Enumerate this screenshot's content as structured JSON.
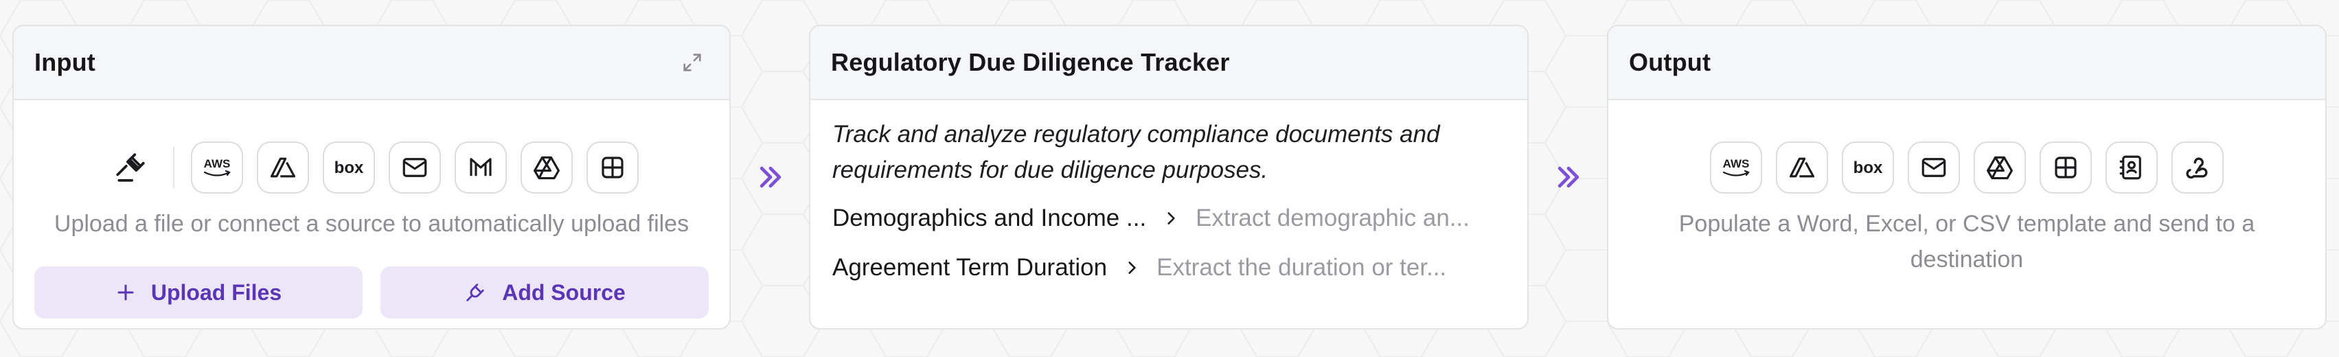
{
  "input": {
    "title": "Input",
    "helper_text": "Upload a file or connect a source to automatically upload files",
    "upload_label": "Upload Files",
    "add_source_label": "Add Source",
    "sources": [
      "gavel-icon",
      "aws-icon",
      "azure-icon",
      "box-icon",
      "mail-icon",
      "gmail-icon",
      "google-drive-icon",
      "sharepoint-icon"
    ]
  },
  "tracker": {
    "title": "Regulatory Due Diligence Tracker",
    "description": "Track and analyze regulatory compliance documents and requirements for due diligence purposes.",
    "fields": [
      {
        "name": "Demographics and Income ...",
        "description": "Extract demographic an..."
      },
      {
        "name": "Agreement Term Duration",
        "description": "Extract the duration or ter..."
      }
    ]
  },
  "output": {
    "title": "Output",
    "helper_text": "Populate a Word, Excel, or CSV template and send to a destination",
    "destinations": [
      "aws-icon",
      "azure-icon",
      "box-icon",
      "mail-icon",
      "google-drive-icon",
      "sharepoint-icon",
      "contacts-icon",
      "webhook-icon"
    ]
  },
  "colors": {
    "accent": "#7c4fd6",
    "button_bg": "#ece6f8",
    "button_text": "#5a35b5"
  }
}
